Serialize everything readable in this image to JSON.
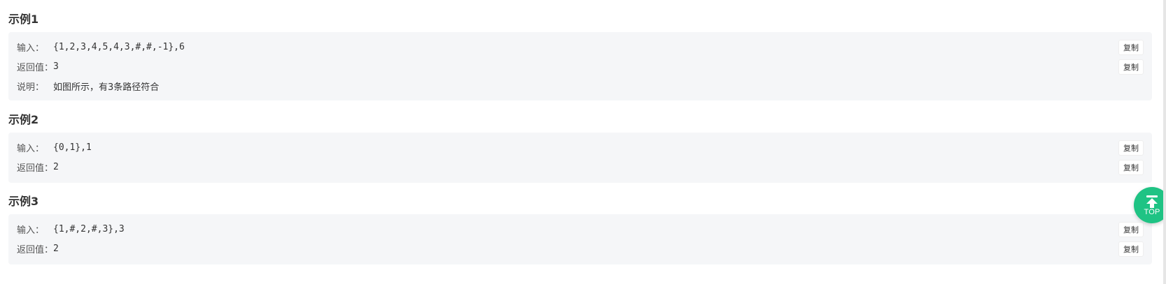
{
  "examples": [
    {
      "title": "示例1",
      "input_label": "输入：",
      "input_value": "{1,2,3,4,5,4,3,#,#,-1},6",
      "return_label": "返回值：",
      "return_value": "3",
      "explain_label": "说明：",
      "explain_value": "如图所示，有3条路径符合",
      "copy_label": "复制"
    },
    {
      "title": "示例2",
      "input_label": "输入：",
      "input_value": "{0,1},1",
      "return_label": "返回值：",
      "return_value": "2",
      "copy_label": "复制"
    },
    {
      "title": "示例3",
      "input_label": "输入：",
      "input_value": "{1,#,2,#,3},3",
      "return_label": "返回值：",
      "return_value": "2",
      "copy_label": "复制"
    }
  ],
  "top_button": {
    "label": "TOP",
    "icon": "arrow-up-to-top-icon",
    "color": "#1fc384"
  },
  "colors": {
    "box_background": "#f5f6f8",
    "text": "#333333"
  }
}
